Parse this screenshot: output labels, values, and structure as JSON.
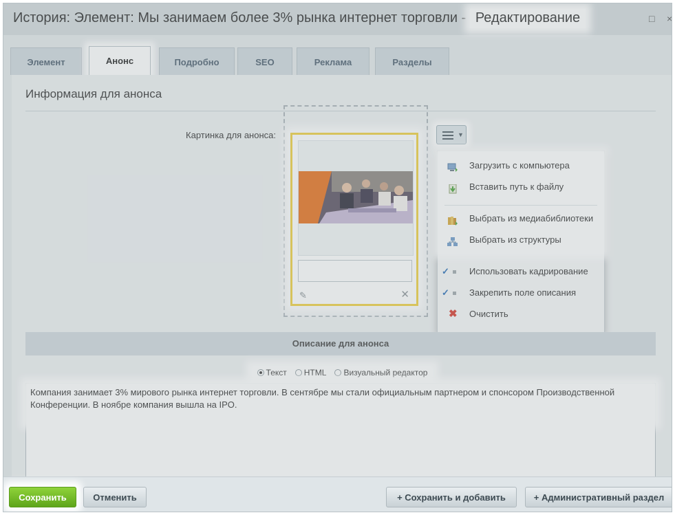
{
  "window": {
    "title_main": "История: Элемент: Мы занимаем более 3% рынка интернет торговли - ",
    "title_highlight": "Редактирование",
    "btn_maximize": "□",
    "btn_close": "×"
  },
  "tabs": [
    {
      "label": "Элемент"
    },
    {
      "label": "Анонс"
    },
    {
      "label": "Подробно"
    },
    {
      "label": "SEO"
    },
    {
      "label": "Реклама"
    },
    {
      "label": "Разделы"
    }
  ],
  "section": {
    "title": "Информация для анонса",
    "picture_label": "Картинка для анонса:"
  },
  "image_card": {
    "edit_icon": "✎",
    "delete_icon": "✕"
  },
  "menu": {
    "items": [
      {
        "label": "Загрузить с компьютера",
        "icon": "computer-upload-icon"
      },
      {
        "label": "Вставить путь к файлу",
        "icon": "file-path-icon"
      },
      {
        "label": "Выбрать из медиабиблиотеки",
        "icon": "medialibrary-icon"
      },
      {
        "label": "Выбрать из структуры",
        "icon": "structure-icon"
      },
      {
        "label": "Использовать кадрирование",
        "checked": true
      },
      {
        "label": "Закрепить поле описания",
        "checked": true
      },
      {
        "label": "Очистить",
        "icon": "clear-icon"
      }
    ],
    "check_glyph": "✓",
    "clear_glyph": "✖"
  },
  "description": {
    "header": "Описание для анонса",
    "modes": [
      {
        "label": "Текст",
        "selected": true
      },
      {
        "label": "HTML",
        "selected": false
      },
      {
        "label": "Визуальный редактор",
        "selected": false
      }
    ],
    "text": "Компания занимает 3% мирового рынка интернет торговли. В сентябре мы стали официальным партнером и спонсором Производственной Конференции. В ноябре компания вышла на IPO."
  },
  "footer": {
    "save": "Сохранить",
    "cancel": "Отменить",
    "save_add": "Сохранить и добавить",
    "admin": "Административный раздел",
    "plus": "+"
  }
}
